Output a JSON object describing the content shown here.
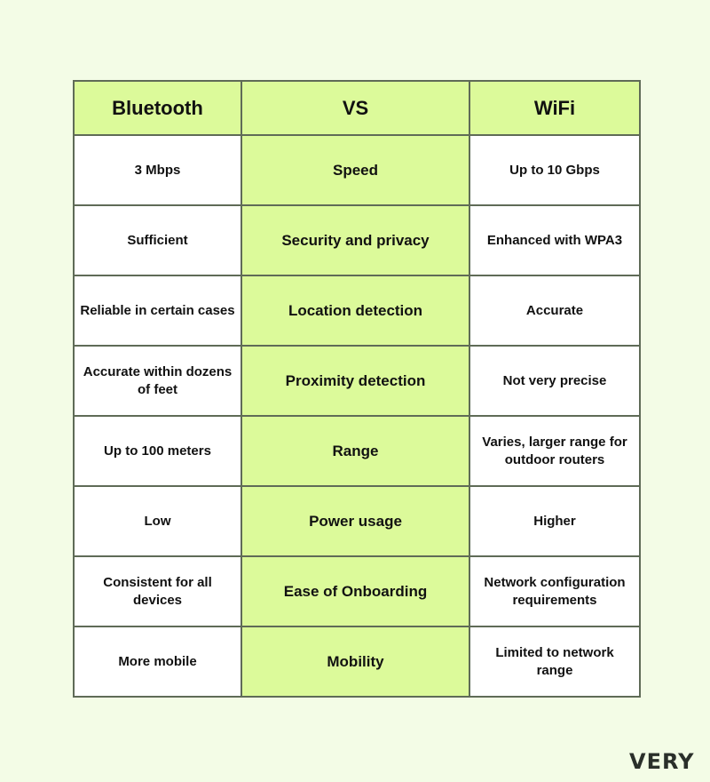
{
  "header": {
    "left": "Bluetooth",
    "middle": "VS",
    "right": "WiFi"
  },
  "rows": [
    {
      "bluetooth": "3 Mbps",
      "feature": "Speed",
      "wifi": "Up to 10 Gbps"
    },
    {
      "bluetooth": "Sufficient",
      "feature": "Security and privacy",
      "wifi": "Enhanced with WPA3"
    },
    {
      "bluetooth": "Reliable in certain cases",
      "feature": "Location detection",
      "wifi": "Accurate"
    },
    {
      "bluetooth": "Accurate within dozens of feet",
      "feature": "Proximity detection",
      "wifi": "Not very precise"
    },
    {
      "bluetooth": "Up to 100 meters",
      "feature": "Range",
      "wifi": "Varies, larger range for outdoor routers"
    },
    {
      "bluetooth": "Low",
      "feature": "Power usage",
      "wifi": "Higher"
    },
    {
      "bluetooth": "Consistent for all devices",
      "feature": "Ease of Onboarding",
      "wifi": "Network configuration requirements"
    },
    {
      "bluetooth": "More mobile",
      "feature": "Mobility",
      "wifi": "Limited to network range"
    }
  ],
  "logo": "VERY",
  "colors": {
    "accent": "#dcfa9a",
    "background": "#f3fce6",
    "border": "#5f6b57"
  }
}
